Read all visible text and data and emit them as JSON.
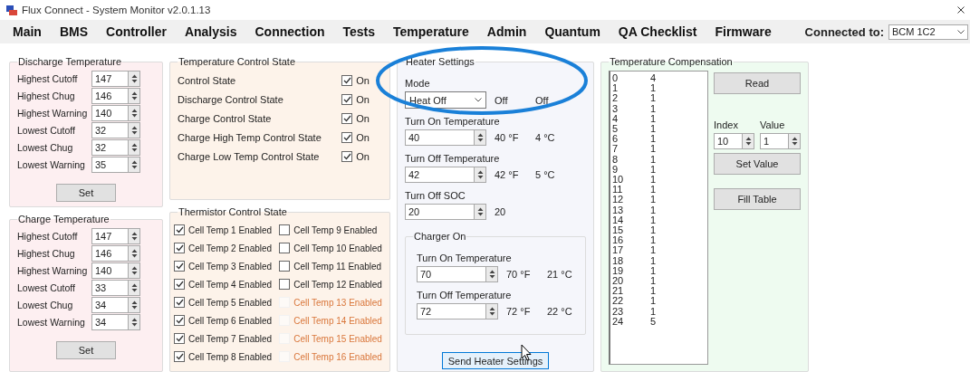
{
  "window": {
    "title": "Flux Connect - System Monitor v2.0.1.13"
  },
  "menu": [
    "Main",
    "BMS",
    "Controller",
    "Analysis",
    "Connection",
    "Tests",
    "Temperature",
    "Admin",
    "Quantum",
    "QA Checklist",
    "Firmware"
  ],
  "connection": {
    "label": "Connected to:",
    "value": "BCM 1C2"
  },
  "discharge_temperature": {
    "title": "Discharge Temperature",
    "button": "Set",
    "fields": [
      {
        "label": "Highest Cutoff",
        "value": "147"
      },
      {
        "label": "Highest Chug",
        "value": "146"
      },
      {
        "label": "Highest Warning",
        "value": "140"
      },
      {
        "label": "Lowest Cutoff",
        "value": "32"
      },
      {
        "label": "Lowest Chug",
        "value": "32"
      },
      {
        "label": "Lowest Warning",
        "value": "35"
      }
    ]
  },
  "charge_temperature": {
    "title": "Charge Temperature",
    "button": "Set",
    "fields": [
      {
        "label": "Highest Cutoff",
        "value": "147"
      },
      {
        "label": "Highest Chug",
        "value": "146"
      },
      {
        "label": "Highest Warning",
        "value": "140"
      },
      {
        "label": "Lowest Cutoff",
        "value": "33"
      },
      {
        "label": "Lowest Chug",
        "value": "34"
      },
      {
        "label": "Lowest Warning",
        "value": "34"
      }
    ]
  },
  "temperature_control_state": {
    "title": "Temperature Control State",
    "items": [
      {
        "label": "Control State",
        "checked": true,
        "text": "On"
      },
      {
        "label": "Discharge Control State",
        "checked": true,
        "text": "On"
      },
      {
        "label": "Charge Control State",
        "checked": true,
        "text": "On"
      },
      {
        "label": "Charge High Temp Control State",
        "checked": true,
        "text": "On"
      },
      {
        "label": "Charge Low Temp Control State",
        "checked": true,
        "text": "On"
      }
    ]
  },
  "thermistor_control_state": {
    "title": "Thermistor Control State",
    "items": [
      {
        "label": "Cell Temp 1 Enabled",
        "checked": true,
        "disabled": false
      },
      {
        "label": "Cell Temp 2 Enabled",
        "checked": true,
        "disabled": false
      },
      {
        "label": "Cell Temp 3 Enabled",
        "checked": true,
        "disabled": false
      },
      {
        "label": "Cell Temp 4 Enabled",
        "checked": true,
        "disabled": false
      },
      {
        "label": "Cell Temp 5 Enabled",
        "checked": true,
        "disabled": false
      },
      {
        "label": "Cell Temp 6 Enabled",
        "checked": true,
        "disabled": false
      },
      {
        "label": "Cell Temp 7 Enabled",
        "checked": true,
        "disabled": false
      },
      {
        "label": "Cell Temp 8 Enabled",
        "checked": true,
        "disabled": false
      },
      {
        "label": "Cell Temp 9 Enabled",
        "checked": false,
        "disabled": false
      },
      {
        "label": "Cell Temp 10 Enabled",
        "checked": false,
        "disabled": false
      },
      {
        "label": "Cell Temp 11 Enabled",
        "checked": false,
        "disabled": false
      },
      {
        "label": "Cell Temp 12 Enabled",
        "checked": false,
        "disabled": false
      },
      {
        "label": "Cell Temp 13 Enabled",
        "checked": false,
        "disabled": true
      },
      {
        "label": "Cell Temp 14 Enabled",
        "checked": false,
        "disabled": true
      },
      {
        "label": "Cell Temp 15 Enabled",
        "checked": false,
        "disabled": true
      },
      {
        "label": "Cell Temp 16 Enabled",
        "checked": false,
        "disabled": true
      }
    ]
  },
  "heater_settings": {
    "title": "Heater Settings",
    "mode": {
      "label": "Mode",
      "value": "Heat Off",
      "readings": [
        "Off",
        "Off"
      ]
    },
    "fields": [
      {
        "label": "Turn On Temperature",
        "value": "40",
        "readings": [
          "40 °F",
          "4 °C"
        ]
      },
      {
        "label": "Turn Off Temperature",
        "value": "42",
        "readings": [
          "42 °F",
          "5 °C"
        ]
      },
      {
        "label": "Turn Off SOC",
        "value": "20",
        "readings": [
          "20"
        ]
      }
    ],
    "charger_on": {
      "title": "Charger On",
      "fields": [
        {
          "label": "Turn On Temperature",
          "value": "70",
          "readings": [
            "70 °F",
            "21 °C"
          ]
        },
        {
          "label": "Turn Off Temperature",
          "value": "72",
          "readings": [
            "72 °F",
            "22 °C"
          ]
        }
      ]
    },
    "button": "Send Heater Settings"
  },
  "temperature_compensation": {
    "title": "Temperature Compensation",
    "rows": [
      {
        "index": "0",
        "value": "4"
      },
      {
        "index": "1",
        "value": "1"
      },
      {
        "index": "2",
        "value": "1"
      },
      {
        "index": "3",
        "value": "1"
      },
      {
        "index": "4",
        "value": "1"
      },
      {
        "index": "5",
        "value": "1"
      },
      {
        "index": "6",
        "value": "1"
      },
      {
        "index": "7",
        "value": "1"
      },
      {
        "index": "8",
        "value": "1"
      },
      {
        "index": "9",
        "value": "1"
      },
      {
        "index": "10",
        "value": "1"
      },
      {
        "index": "11",
        "value": "1"
      },
      {
        "index": "12",
        "value": "1"
      },
      {
        "index": "13",
        "value": "1"
      },
      {
        "index": "14",
        "value": "1"
      },
      {
        "index": "15",
        "value": "1"
      },
      {
        "index": "16",
        "value": "1"
      },
      {
        "index": "17",
        "value": "1"
      },
      {
        "index": "18",
        "value": "1"
      },
      {
        "index": "19",
        "value": "1"
      },
      {
        "index": "20",
        "value": "1"
      },
      {
        "index": "21",
        "value": "1"
      },
      {
        "index": "22",
        "value": "1"
      },
      {
        "index": "23",
        "value": "1"
      },
      {
        "index": "24",
        "value": "5"
      }
    ],
    "read_button": "Read",
    "index": {
      "label": "Index",
      "value": "10"
    },
    "value": {
      "label": "Value",
      "value": "1"
    },
    "set_button": "Set Value",
    "fill_button": "Fill Table"
  }
}
